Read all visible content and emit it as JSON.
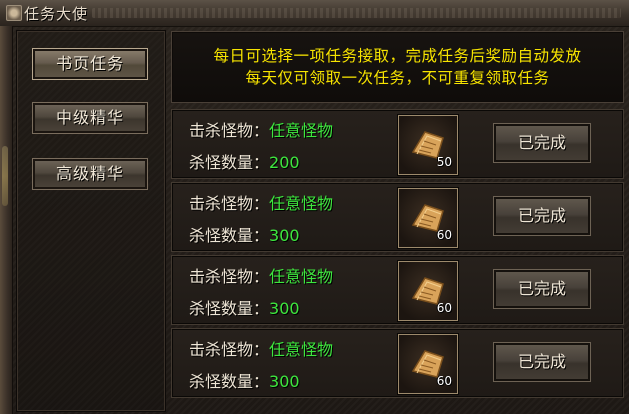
{
  "window": {
    "title": "任务大使"
  },
  "nav": [
    {
      "label": "书页任务",
      "active": true
    },
    {
      "label": "中级精华",
      "active": false
    },
    {
      "label": "高级精华",
      "active": false
    }
  ],
  "notice": {
    "line1": "每日可选择一项任务接取，完成任务后奖励自动发放",
    "line2": "每天仅可领取一次任务，不可重复领取任务"
  },
  "tasks": [
    {
      "kill_label": "击杀怪物：",
      "kill_value": "任意怪物",
      "count_label": "杀怪数量：",
      "count_value": "200",
      "reward_icon": "book-page-icon",
      "reward_count": "50",
      "status": "已完成"
    },
    {
      "kill_label": "击杀怪物：",
      "kill_value": "任意怪物",
      "count_label": "杀怪数量：",
      "count_value": "300",
      "reward_icon": "book-page-icon",
      "reward_count": "60",
      "status": "已完成"
    },
    {
      "kill_label": "击杀怪物：",
      "kill_value": "任意怪物",
      "count_label": "杀怪数量：",
      "count_value": "300",
      "reward_icon": "book-page-icon",
      "reward_count": "60",
      "status": "已完成"
    },
    {
      "kill_label": "击杀怪物：",
      "kill_value": "任意怪物",
      "count_label": "杀怪数量：",
      "count_value": "300",
      "reward_icon": "book-page-icon",
      "reward_count": "60",
      "status": "已完成"
    }
  ],
  "colors": {
    "notice_text": "#f7e400",
    "value_text": "#3ee63e",
    "label_text": "#efe6d6"
  }
}
